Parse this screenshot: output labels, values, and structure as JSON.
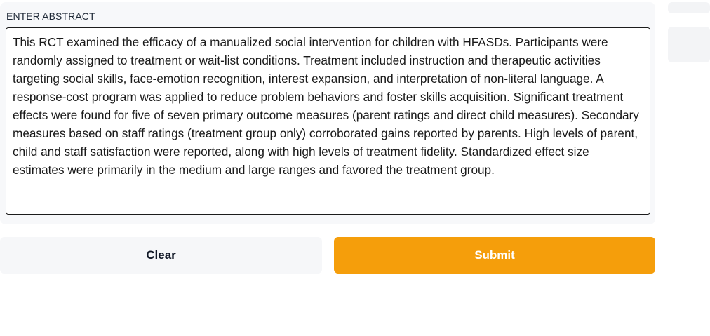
{
  "form": {
    "label": "ENTER ABSTRACT",
    "abstract_text": "This RCT examined the efficacy of a manualized social intervention for children with HFASDs. Participants were randomly assigned to treatment or wait-list conditions. Treatment included instruction and therapeutic activities targeting social skills, face-emotion recognition, interest expansion, and interpretation of non-literal language. A response-cost program was applied to reduce problem behaviors and foster skills acquisition. Significant treatment effects were found for five of seven primary outcome measures (parent ratings and direct child measures). Secondary measures based on staff ratings (treatment group only) corroborated gains reported by parents. High levels of parent, child and staff satisfaction were reported, along with high levels of treatment fidelity. Standardized effect size estimates were primarily in the medium and large ranges and favored the treatment group."
  },
  "actions": {
    "clear_label": "Clear",
    "submit_label": "Submit"
  },
  "colors": {
    "submit_accent": "#f59e0b",
    "panel_background": "#f7f8fa"
  }
}
